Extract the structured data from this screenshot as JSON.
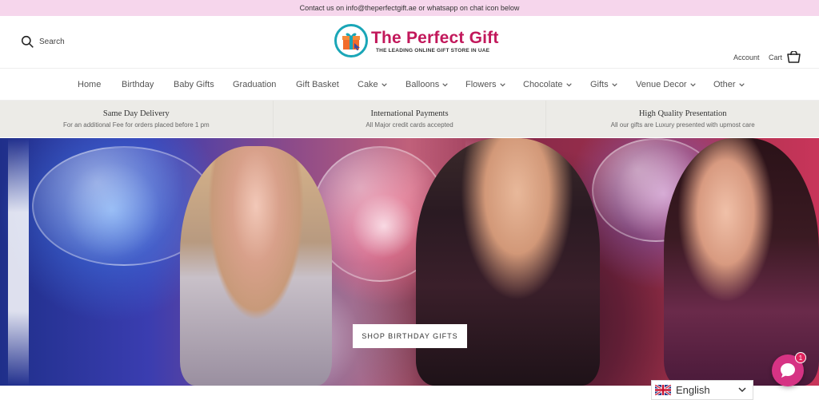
{
  "announcement": "Contact us on info@theperfectgift.ae or whatsapp on chat icon below",
  "header": {
    "search_label": "Search",
    "logo_title": "The Perfect Gift",
    "logo_subtitle": "THE LEADING ONLINE GIFT STORE IN UAE",
    "account_label": "Account",
    "cart_label": "Cart"
  },
  "nav": [
    {
      "label": "Home",
      "dropdown": false
    },
    {
      "label": "Birthday",
      "dropdown": false
    },
    {
      "label": "Baby Gifts",
      "dropdown": false
    },
    {
      "label": "Graduation",
      "dropdown": false
    },
    {
      "label": "Gift Basket",
      "dropdown": false
    },
    {
      "label": "Cake",
      "dropdown": true
    },
    {
      "label": "Balloons",
      "dropdown": true
    },
    {
      "label": "Flowers",
      "dropdown": true
    },
    {
      "label": "Chocolate",
      "dropdown": true
    },
    {
      "label": "Gifts",
      "dropdown": true
    },
    {
      "label": "Venue Decor",
      "dropdown": true
    },
    {
      "label": "Other",
      "dropdown": true
    }
  ],
  "features": [
    {
      "title": "Same Day Delivery",
      "desc": "For an additional Fee for orders placed before 1 pm"
    },
    {
      "title": "International Payments",
      "desc": "All Major credit cards accepted"
    },
    {
      "title": "High Quality Presentation",
      "desc": "All our gifts are Luxury presented with upmost care"
    }
  ],
  "hero": {
    "button_label": "SHOP BIRTHDAY GIFTS"
  },
  "chat": {
    "badge_count": "1"
  },
  "language": {
    "selected": "English"
  },
  "colors": {
    "announcement_bg": "#f6d6ec",
    "brand_pink": "#c2185b",
    "brand_teal": "#1aa6b7",
    "chat_pink": "#d63384"
  }
}
